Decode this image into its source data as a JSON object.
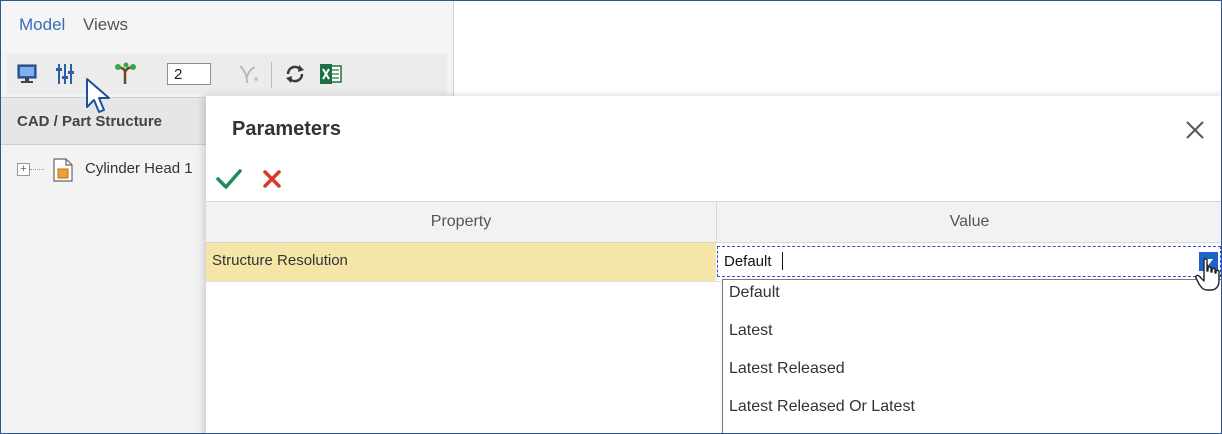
{
  "menu": {
    "model": "Model",
    "views": "Views"
  },
  "toolbar": {
    "level_value": "2"
  },
  "left_panel": {
    "header": "CAD / Part Structure",
    "tree_item": "Cylinder Head 1"
  },
  "dialog": {
    "title": "Parameters",
    "columns": {
      "property": "Property",
      "value": "Value"
    },
    "row": {
      "property": "Structure Resolution",
      "value": "Default"
    },
    "dropdown_options": [
      "Default",
      "Latest",
      "Latest Released",
      "Latest Released Or Latest"
    ]
  },
  "colors": {
    "accent": "#3b6db5",
    "selected_row": "#f5e6a8",
    "ok_check": "#1f8a5a",
    "cancel_x": "#d63a2a",
    "dropdown_button": "#1d63c7"
  }
}
